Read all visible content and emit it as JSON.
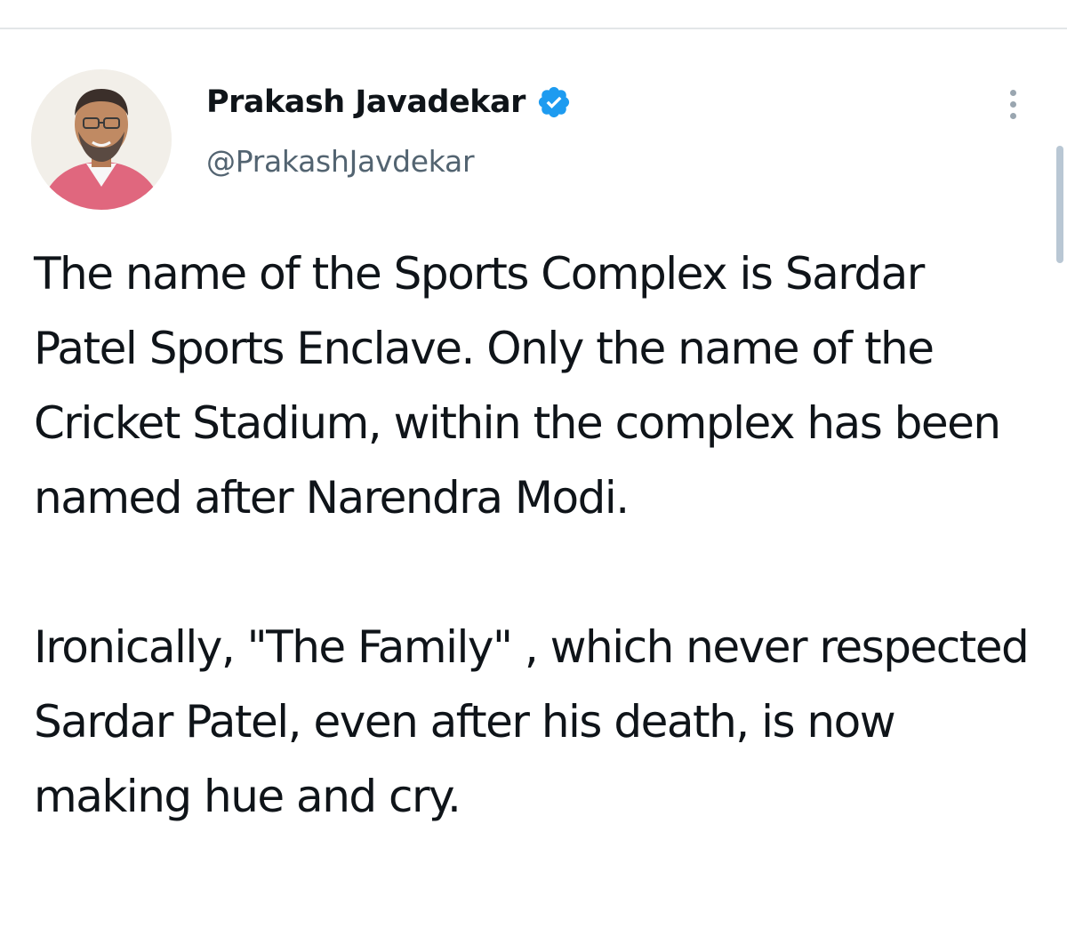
{
  "tweet": {
    "author": {
      "display_name": "Prakash Javadekar",
      "handle": "@PrakashJavdekar",
      "verified": true,
      "verified_icon": "verified-badge-icon",
      "avatar_icon": "profile-avatar"
    },
    "more_icon": "more-options-icon",
    "paragraphs": [
      "The name of the Sports Complex is Sardar Patel Sports Enclave. Only the name of the Cricket Stadium, within the complex has been named after Narendra Modi.",
      "Ironically, \"The Family\" , which never respected Sardar Patel, even after his death, is now making hue and cry."
    ]
  },
  "colors": {
    "text_primary": "#0f1419",
    "text_secondary": "#536471",
    "verified_blue": "#1d9bf0",
    "divider": "#e3e6e8",
    "scrollbar": "#b9c7d4"
  }
}
